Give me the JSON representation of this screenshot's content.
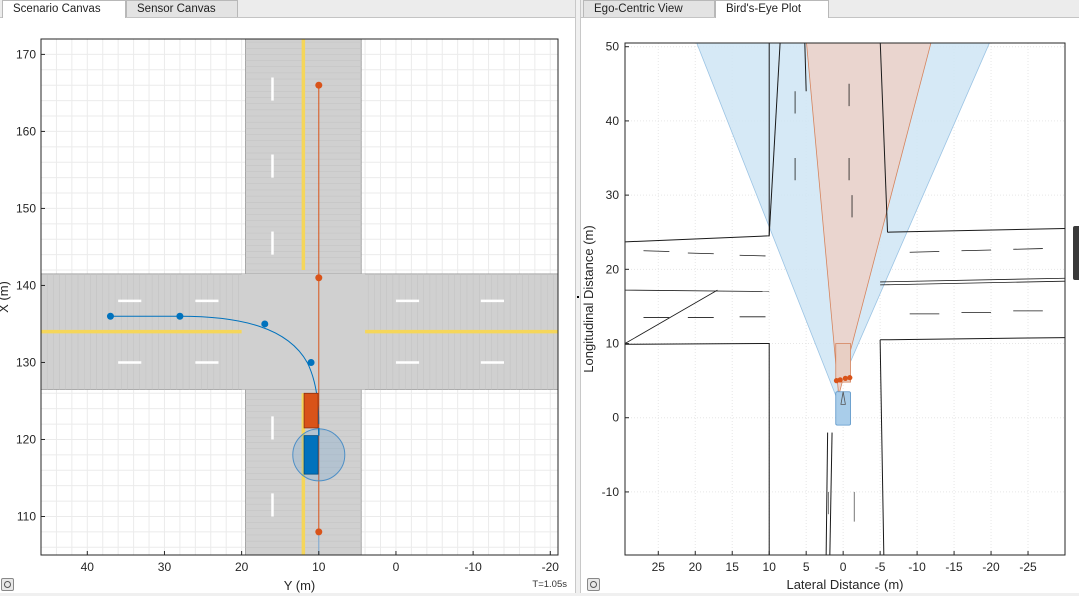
{
  "left": {
    "tabs": [
      {
        "label": "Scenario Canvas",
        "active": true
      },
      {
        "label": "Sensor Canvas",
        "active": false
      }
    ],
    "y_axis": {
      "label": "X (m)",
      "ticks": [
        110,
        120,
        130,
        140,
        150,
        160,
        170
      ],
      "range": [
        105,
        172
      ]
    },
    "x_axis": {
      "label": "Y (m)",
      "ticks": [
        40,
        30,
        20,
        10,
        0,
        -10,
        -20
      ],
      "range": [
        46,
        -21
      ]
    },
    "time_label": "T=1.05s",
    "colors": {
      "ego": "#0072bd",
      "target": "#d95319",
      "road": "#d0d0d0",
      "lane_yellow": "#f5d65a"
    },
    "blue_waypoints": [
      [
        37,
        136
      ],
      [
        28,
        136
      ],
      [
        17,
        135
      ],
      [
        11,
        130
      ]
    ],
    "orange_waypoints": [
      [
        10,
        166
      ],
      [
        10,
        141
      ],
      [
        10,
        108
      ]
    ]
  },
  "right": {
    "tabs": [
      {
        "label": "Ego-Centric View",
        "active": false
      },
      {
        "label": "Bird's-Eye Plot",
        "active": true
      }
    ],
    "y_axis": {
      "label": "Longitudinal Distance (m)",
      "ticks": [
        -10,
        0,
        10,
        20,
        30,
        40,
        50
      ],
      "range": [
        -18.5,
        50.5
      ]
    },
    "x_axis": {
      "label": "Lateral Distance (m)",
      "ticks": [
        25,
        20,
        15,
        10,
        5,
        0,
        -5,
        -10,
        -15,
        -20,
        -25
      ],
      "range": [
        29.5,
        -30
      ]
    },
    "colors": {
      "radar_coverage": "#cfe5f5",
      "vision_coverage": "#ecd3cb",
      "ego": "#a9cdea",
      "target": "#d95319"
    }
  },
  "icons": [
    "settings-icon"
  ]
}
